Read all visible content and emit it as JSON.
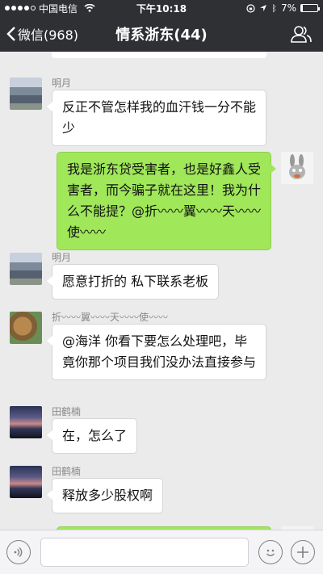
{
  "status_bar": {
    "carrier": "中国电信",
    "time": "下午10:18",
    "battery_percent": "7%"
  },
  "nav": {
    "back_label": "微信(968)",
    "title": "情系浙东(44)"
  },
  "messages": [
    {
      "sender": "明月",
      "text": "反正不管怎样我的血汗钱一分不能少"
    },
    {
      "text": "我是浙东贷受害者，也是好鑫人受害者，而今骗子就在这里！我为什么不能提？@折〰〰翼〰〰天〰〰使〰〰"
    },
    {
      "sender": "明月",
      "text": "愿意打折的 私下联系老板"
    },
    {
      "sender": "折〰〰翼〰〰天〰〰使〰〰",
      "text": "@海洋 你看下要怎么处理吧，毕竟你那个项目我们没办法直接参与"
    },
    {
      "sender": "田鹤楠",
      "text": "在，怎么了"
    },
    {
      "sender": "田鹤楠",
      "text": "释放多少股权啊"
    }
  ],
  "colors": {
    "nav_bg": "#2f3034",
    "chat_bg": "#ebebeb",
    "sent_bubble": "#a0e75a",
    "received_bubble": "#ffffff"
  },
  "icons": [
    "signal-dots-icon",
    "wifi-icon",
    "location-icon",
    "battery-icon",
    "back-chevron-icon",
    "group-members-icon",
    "voice-icon",
    "emoji-icon",
    "plus-icon"
  ]
}
